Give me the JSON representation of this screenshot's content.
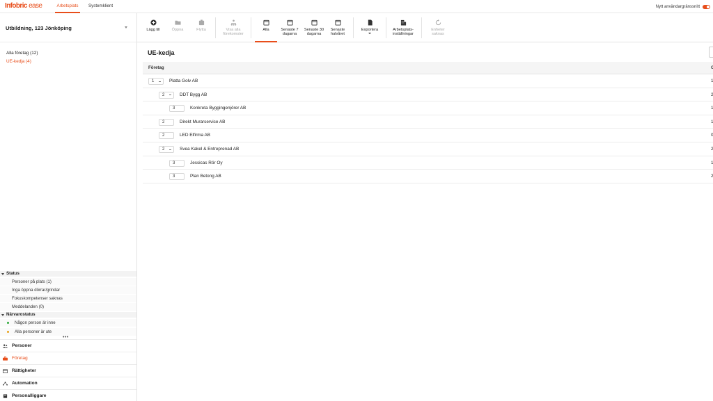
{
  "topbar": {
    "logo_main": "Infobric",
    "logo_sub": "ease",
    "tabs": [
      {
        "label": "Arbetsplats",
        "active": true
      },
      {
        "label": "Systemklient",
        "active": false
      }
    ],
    "toggle_label": "Nytt användargränssnitt",
    "accent": "#e84e1b"
  },
  "sidebar": {
    "site": "Utbildning, 123 Jönköping",
    "tree": [
      {
        "label": "Alla företag (12)",
        "active": false
      },
      {
        "label": "UE-kedja (4)",
        "active": true
      }
    ],
    "status": {
      "title": "Status",
      "items": [
        "Personer på plats (1)",
        "Inga öppna dörrar/grindar",
        "Fokuskompetenser saknas",
        "Meddelanden (0)"
      ]
    },
    "presence": {
      "title": "Närvarostatus",
      "items": [
        {
          "label": "Någon person är inne",
          "color": "#2eaa3a"
        },
        {
          "label": "Alla personer är ute",
          "color": "#e8a21b"
        }
      ]
    },
    "more": "•••",
    "nav": [
      {
        "label": "Personer",
        "icon": "people-icon",
        "active": false
      },
      {
        "label": "Företag",
        "icon": "briefcase-icon",
        "active": true
      },
      {
        "label": "Rättigheter",
        "icon": "calendar-icon",
        "active": false
      },
      {
        "label": "Automation",
        "icon": "network-icon",
        "active": false
      },
      {
        "label": "Personalliggare",
        "icon": "book-icon",
        "active": false
      }
    ]
  },
  "toolbar": {
    "add": "Lägg till",
    "open": "Öppna",
    "move": "Flytta",
    "show_all": "Visa alla förekomster",
    "all": "Alla",
    "last7": "Senaste 7 dagarna",
    "last30": "Senaste 30 dagarna",
    "halfyear": "Senaste halvåret",
    "export": "Exportera",
    "settings": "Arbetsplats-inställningar",
    "units": "Enheter saknas"
  },
  "main": {
    "title": "UE-kedja",
    "column": "Företag",
    "column_right": "G",
    "rows": [
      {
        "level": "1",
        "name": "Platta Golv AB",
        "value": "1",
        "collapsible": true
      },
      {
        "level": "2",
        "name": "DDT Bygg AB",
        "value": "2",
        "collapsible": true
      },
      {
        "level": "3",
        "name": "Konkreta Byggingenjörer AB",
        "value": "1",
        "collapsible": false
      },
      {
        "level": "2",
        "name": "Direkt Murarservice AB",
        "value": "1",
        "collapsible": false
      },
      {
        "level": "2",
        "name": "LED Elfirma AB",
        "value": "0",
        "collapsible": false
      },
      {
        "level": "2",
        "name": "Svea Kakel & Entreprenad AB",
        "value": "2",
        "collapsible": true
      },
      {
        "level": "3",
        "name": "Jessicas Rör Oy",
        "value": "1",
        "collapsible": false
      },
      {
        "level": "3",
        "name": "Plan Betong AB",
        "value": "2",
        "collapsible": false
      }
    ]
  }
}
